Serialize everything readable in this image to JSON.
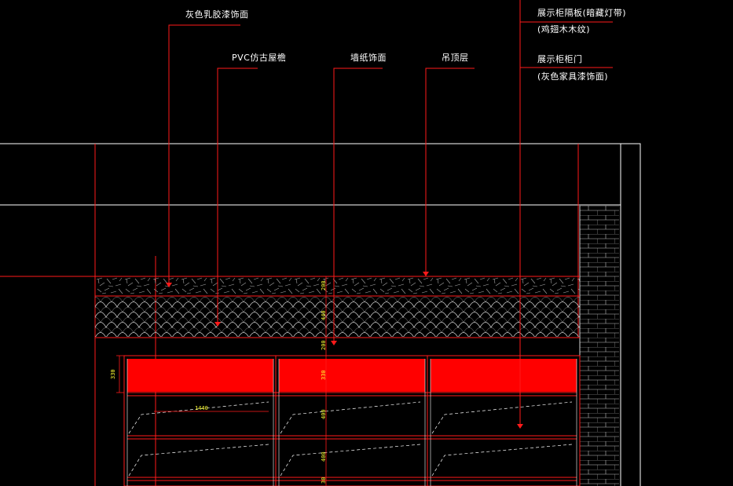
{
  "drawing": {
    "annotations": {
      "gray_latex_paint": "灰色乳胶漆饰面",
      "pvc_eave": "PVC仿古屋檐",
      "wallpaper": "墙纸饰面",
      "ceiling": "吊顶层",
      "display_shelf_line1": "展示柜隔板(暗藏灯带)",
      "display_shelf_line2": "(鸡翅木木纹)",
      "display_door_line1": "展示柜柜门",
      "display_door_line2": "(灰色家具漆饰面)"
    },
    "dimensions": {
      "d200_top": "200",
      "d440": "440",
      "d200_mid": "200",
      "d330_left": "330",
      "d330_mid": "330",
      "d1440": "1440",
      "d400_a": "400",
      "d400_b": "400",
      "d30": "30"
    },
    "colors": {
      "leader_red": "#ff1a1a",
      "fill_red": "#ff0000",
      "line_white": "#ffffff",
      "dim_yellow": "#ffff33",
      "background": "#000000"
    }
  }
}
